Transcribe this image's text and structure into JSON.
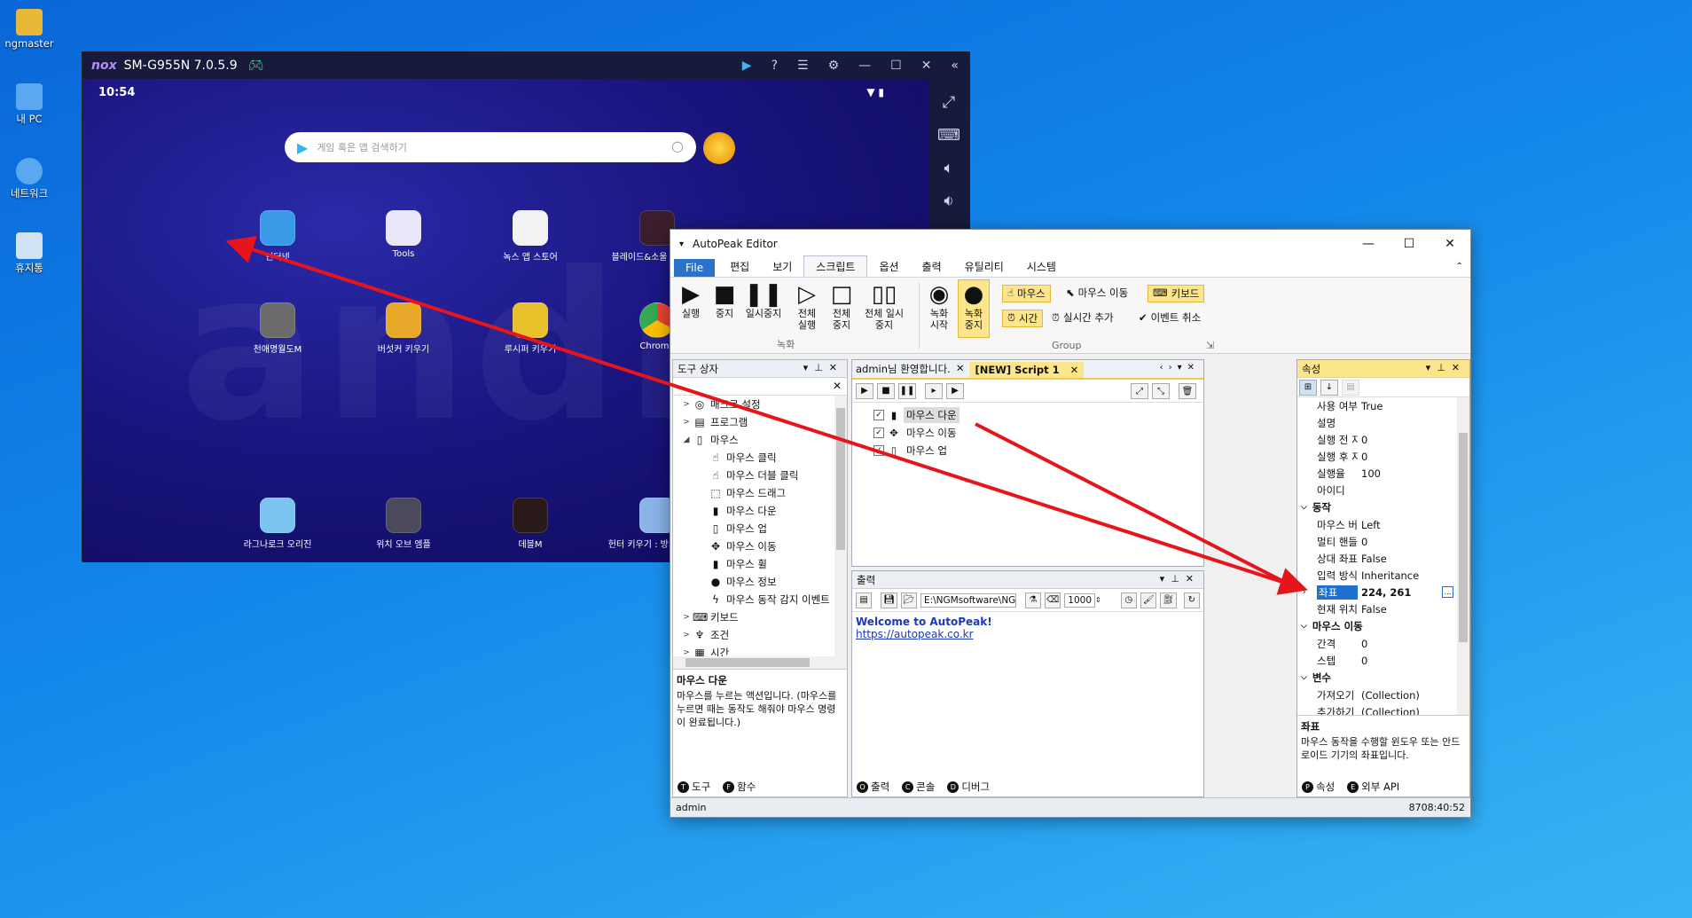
{
  "desktop": {
    "icons": [
      {
        "label": "ngmaster",
        "color": "#e8b838"
      },
      {
        "label": "내 PC",
        "color": "#5aa9f0"
      },
      {
        "label": "네트워크",
        "color": "#5aa9f0"
      },
      {
        "label": "휴지통",
        "color": "#cfe3f5"
      }
    ]
  },
  "nox": {
    "brand": "nox",
    "title": "SM-G955N 7.0.5.9",
    "clock": "10:54",
    "search_placeholder": "게임 혹은 앱 검색하기",
    "apps": [
      {
        "label": "인터넷",
        "color": "#3b9ae8"
      },
      {
        "label": "Tools",
        "color": "#e8e8f8"
      },
      {
        "label": "녹스 앱 스토어",
        "color": "#f2f2f2"
      },
      {
        "label": "블레이드&소울 레볼루션",
        "color": "#3a1e2e"
      },
      {
        "label": "천애명월도M",
        "color": "#6b6b6b"
      },
      {
        "label": "버섯커 키우기",
        "color": "#e8a92a"
      },
      {
        "label": "루시퍼 키우기",
        "color": "#e8c02a"
      },
      {
        "label": "Chrome",
        "color": "#ffffff"
      },
      {
        "label": "라그나로크 오리진",
        "color": "#7ac4f0"
      },
      {
        "label": "위치 오브 엠플",
        "color": "#4a4a5a"
      },
      {
        "label": "데블M",
        "color": "#2a1a1a"
      },
      {
        "label": "헌터 키우기 : 방치형 RPG",
        "color": "#8ab4e8"
      }
    ],
    "android_watermark": "andro"
  },
  "autopeak": {
    "title": "AutoPeak Editor",
    "menu": [
      "File",
      "편집",
      "보기",
      "스크립트",
      "옵션",
      "출력",
      "유틸리티",
      "시스템"
    ],
    "active_menu": "스크립트",
    "ribbon": {
      "run": "실행",
      "stop": "중지",
      "pause": "일시중지",
      "run_all": "전체 실행",
      "stop_all": "전체 중지",
      "pause_all": "전체 일시중지",
      "record_group": "녹화",
      "rec_start": "녹화 시작",
      "rec_stop": "녹화 중지",
      "mouse": "마우스",
      "mouse_move": "마우스 이동",
      "keyboard": "키보드",
      "time": "시간",
      "realtime_add": "실시간 추가",
      "event_cancel": "이벤트 취소",
      "group_label": "Group"
    },
    "toolbox": {
      "title": "도구 상자",
      "items": [
        {
          "label": "매크로 설정",
          "level": 0,
          "exp": ">",
          "icon": "◎"
        },
        {
          "label": "프로그램",
          "level": 0,
          "exp": ">",
          "icon": "▤"
        },
        {
          "label": "마우스",
          "level": 0,
          "exp": "◢",
          "icon": "▯"
        },
        {
          "label": "마우스 클릭",
          "level": 1,
          "exp": "",
          "icon": "☝"
        },
        {
          "label": "마우스 더블 클릭",
          "level": 1,
          "exp": "",
          "icon": "☝"
        },
        {
          "label": "마우스 드래그",
          "level": 1,
          "exp": "",
          "icon": "⬚"
        },
        {
          "label": "마우스 다운",
          "level": 1,
          "exp": "",
          "icon": "▮"
        },
        {
          "label": "마우스 업",
          "level": 1,
          "exp": "",
          "icon": "▯"
        },
        {
          "label": "마우스 이동",
          "level": 1,
          "exp": "",
          "icon": "✥"
        },
        {
          "label": "마우스 휠",
          "level": 1,
          "exp": "",
          "icon": "▮"
        },
        {
          "label": "마우스 정보",
          "level": 1,
          "exp": "",
          "icon": "●"
        },
        {
          "label": "마우스 동작 감지 이벤트",
          "level": 1,
          "exp": "",
          "icon": "ϟ"
        },
        {
          "label": "키보드",
          "level": 0,
          "exp": ">",
          "icon": "⌨"
        },
        {
          "label": "조건",
          "level": 0,
          "exp": ">",
          "icon": "♆"
        },
        {
          "label": "시간",
          "level": 0,
          "exp": ">",
          "icon": "▦"
        }
      ],
      "desc_title": "마우스 다운",
      "desc_text": "마우스를 누르는 액션입니다. (마우스를 누르면 때는 동작도 해줘야 마우스 명령이 완료됩니다.)",
      "tabs": [
        "도구",
        "함수"
      ]
    },
    "editor": {
      "tabs": [
        "admin님 환영합니다.",
        "[NEW] Script 1"
      ],
      "items": [
        {
          "label": "마우스 다운",
          "icon": "▮",
          "selected": true
        },
        {
          "label": "마우스 이동",
          "icon": "✥",
          "selected": false
        },
        {
          "label": "마우스 업",
          "icon": "▯",
          "selected": false
        }
      ]
    },
    "output": {
      "title": "출력",
      "path": "E:\\NGMsoftware\\NG",
      "count": "1000",
      "welcome": "Welcome to AutoPeak!",
      "link": "https://autopeak.co.kr",
      "tabs": [
        "출력",
        "콘솔",
        "디버그"
      ]
    },
    "properties": {
      "title": "속성",
      "rows_general": [
        {
          "name": "사용 여부",
          "value": "True"
        },
        {
          "name": "설명",
          "value": ""
        },
        {
          "name": "실행 전 지연",
          "value": "0"
        },
        {
          "name": "실행 후 지연",
          "value": "0"
        },
        {
          "name": "실행율",
          "value": "100"
        },
        {
          "name": "아이디",
          "value": ""
        }
      ],
      "cat_action": "동작",
      "rows_action": [
        {
          "name": "마우스 버튼",
          "value": "Left"
        },
        {
          "name": "멀티 핸들",
          "value": "0"
        },
        {
          "name": "상대 좌표",
          "value": "False"
        },
        {
          "name": "입력 방식",
          "value": "Inheritance"
        },
        {
          "name": "좌표",
          "value": "224, 261"
        },
        {
          "name": "현재 위치",
          "value": "False"
        }
      ],
      "cat_move": "마우스 이동",
      "rows_move": [
        {
          "name": "간격",
          "value": "0"
        },
        {
          "name": "스텝",
          "value": "0"
        }
      ],
      "cat_var": "변수",
      "rows_var": [
        {
          "name": "가져오기",
          "value": "(Collection)"
        },
        {
          "name": "추가하기",
          "value": "(Collection)"
        }
      ],
      "desc_title": "좌표",
      "desc_text": "마우스 동작을 수행할 윈도우 또는 안드로이드 기기의 좌표입니다.",
      "tabs": [
        "속성",
        "외부 API"
      ]
    },
    "status": {
      "user": "admin",
      "time": "8708:40:52"
    }
  }
}
